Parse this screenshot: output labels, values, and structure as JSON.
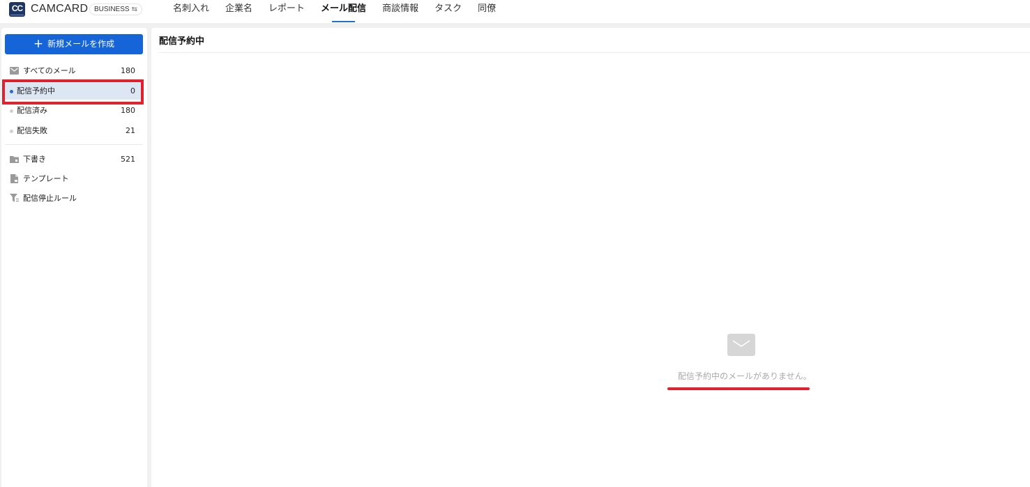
{
  "app": {
    "logo_text": "CC",
    "brand": "CAMCARD",
    "edition": "BUSINESS",
    "edition_swap_icon": "swap-icon"
  },
  "nav": {
    "items": [
      {
        "label": "名刺入れ"
      },
      {
        "label": "企業名"
      },
      {
        "label": "レポート"
      },
      {
        "label": "メール配信",
        "active": true
      },
      {
        "label": "商談情報"
      },
      {
        "label": "タスク"
      },
      {
        "label": "同僚"
      }
    ]
  },
  "sidebar": {
    "new_mail_label": "新規メールを作成",
    "items": [
      {
        "label": "すべてのメール",
        "count": "180",
        "icon": "mail-icon"
      },
      {
        "label": "配信予約中",
        "count": "0",
        "selected": true
      },
      {
        "label": "配信済み",
        "count": "180"
      },
      {
        "label": "配信失敗",
        "count": "21"
      },
      {
        "label": "下書き",
        "count": "521",
        "icon": "folder-icon"
      },
      {
        "label": "テンプレート",
        "icon": "document-icon"
      },
      {
        "label": "配信停止ルール",
        "icon": "filter-icon"
      }
    ]
  },
  "main": {
    "title": "配信予約中",
    "empty_message": "配信予約中のメールがありません。",
    "empty_icon": "mail-icon"
  },
  "colors": {
    "primary": "#1565d8",
    "annotation": "#e3202d",
    "selected_bg": "#dde6f3"
  }
}
